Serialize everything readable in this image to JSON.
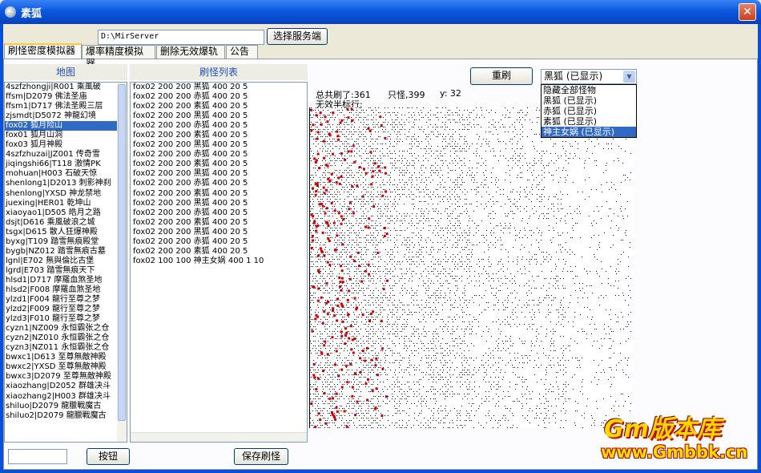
{
  "window": {
    "title": "素狐",
    "close_glyph": "✕"
  },
  "server": {
    "path_value": "D:\\MirServer",
    "select_button": "选择服务端"
  },
  "tabs": [
    {
      "label": "刷怪密度模拟器",
      "active": true
    },
    {
      "label": "爆率精度模拟器"
    },
    {
      "label": "删除无效爆轨"
    },
    {
      "label": "公告"
    }
  ],
  "map_list": {
    "header": "地图",
    "items": [
      "4szfzhongji|R001 乘風破",
      "ffsm|D2079 佛法圣庙",
      "ffsm1|D717 佛法圣殿三层",
      "zjsmdt|D5072 神龍幻境",
      "fox02 狐月险山",
      "fox01 狐月山洞",
      "fox03 狐月神殿",
      "4szfzhuzai|JZ001 传奇雪",
      "jiqingshi66|T118 激情PK",
      "mohuan|H003 石破天惊",
      "shenlong1|D2013 刺影神刹",
      "shenlong|YXSD 神龙禁地",
      "juexing|HER01  乾坤山",
      "xiaoyao1|D505 皓月之路",
      "dsjt|D616 乘風破浪之城",
      "tsgx|D615 散人狂爆神殿",
      "byxg|T109 踏雪無痕殿堂",
      "bygb|NZ012 踏雪無痕古墓",
      "lgnl|E702 無與倫比古堡",
      "lgrd|E703 踏雪無痕天下",
      "hlsd1|D717 摩羅血煞圣地",
      "hlsd2|F008 摩羅血煞圣地",
      "ylzd1|F004 龍行至尊之梦",
      "ylzd2|F009 龍行至尊之梦",
      "ylzd3|F010 龍行至尊之梦",
      "cyzn1|NZ009 永恒霸张之仓",
      "cyzn2|NZ010 永恒霸张之仓",
      "cyzn3|NZ011 永恒霸张之仓",
      "bwxc1|D613 至尊無敵神殿",
      "bwxc2|YXSD 至尊無敵神殿",
      "bwxc3|D2079 至尊無敵神殿",
      "xiaozhang|D2052 群雄决斗",
      "xiaozhang2|H003 群雄决斗",
      "shiluo|D2079 龍臘戰魔古",
      "shiluo2|D2079 龍臘戰魔古"
    ],
    "selected_index": 4
  },
  "spawn_list": {
    "header": "刷怪列表",
    "items": [
      "fox02 200 200 黑狐 400 20 5",
      "fox02 200 200 赤狐 400 20 5",
      "fox02 200 200 素狐 400 20 5",
      "fox02 200 200 黑狐 400 20 5",
      "fox02 200 200 赤狐 400 20 5",
      "fox02 200 200 素狐 400 20 5",
      "fox02 200 200 黑狐 400 20 5",
      "fox02 200 200 赤狐 400 20 5",
      "fox02 200 200 素狐 400 20 5",
      "fox02 200 200 黑狐 400 20 5",
      "fox02 200 200 赤狐 400 20 5",
      "fox02 200 200 素狐 400 20 5",
      "fox02 200 200 黑狐 400 20 5",
      "fox02 200 200 赤狐 400 20 5",
      "fox02 200 200 素狐 400 20 5",
      "fox02 200 200 黑狐 400 20 5",
      "fox02 200 200 赤狐 400 20 5",
      "fox02 200 200 素狐 400 20 5",
      "fox02 100 100 神主女娲 400 1 10"
    ]
  },
  "bottom": {
    "button_label": "按钮",
    "save_button": "保存刷怪",
    "small_input_value": ""
  },
  "simulator": {
    "refresh_button": "重刷",
    "total_label": "总共刷了:361",
    "count_label": "只怪,399",
    "y_label": "y: 32",
    "invalid_label": "无效半标行:",
    "combo_value": "黑狐 (已显示)",
    "dropdown_options": [
      "隐藏全部怪物",
      "黑狐 (已显示)",
      "赤狐 (已显示)",
      "素狐 (已显示)",
      "神主女娲 (已显示)"
    ],
    "dropdown_selected_index": 4
  },
  "watermark": {
    "top": "Gm版本库",
    "bottom": "www.Gmbbk.cn"
  },
  "colors": {
    "title_blue": "#0a58e0",
    "selection": "#316ac5",
    "monster_dot": "#cc0000",
    "watermark_yellow": "#ffd600"
  }
}
